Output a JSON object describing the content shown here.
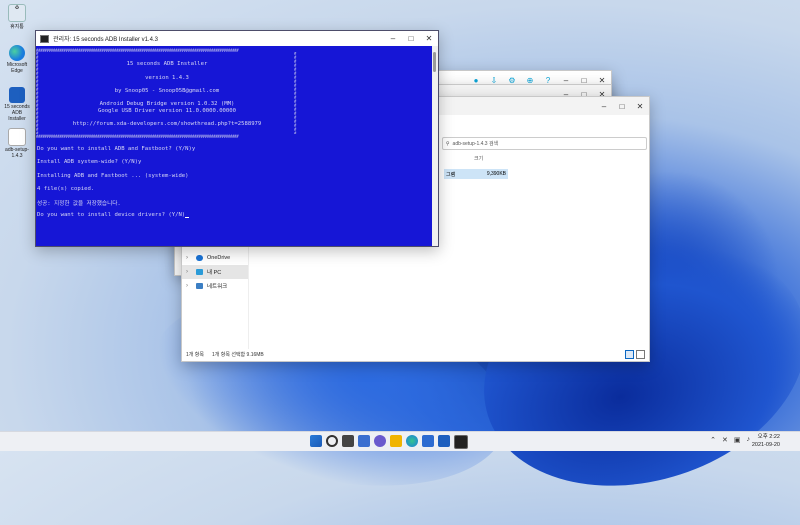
{
  "desktop": {
    "icons": [
      {
        "label": "휴지통",
        "icon": "recycle-bin-icon"
      },
      {
        "label": "Microsoft Edge",
        "icon": "edge-icon"
      },
      {
        "label": "15 seconds ADB Installer",
        "icon": "installer-icon"
      },
      {
        "label": "adb-setup-1.4.3",
        "icon": "file-icon"
      }
    ]
  },
  "console": {
    "title": "관리자: 15 seconds ADB Installer v1.4.3",
    "banner": [
      "15 seconds ADB Installer",
      "version 1.4.3",
      "by Snoop05 - Snoop05B@gmail.com",
      "Android Debug Bridge version 1.0.32 (MM)",
      "Google USB Driver version 11.0.0000.00000",
      "http://forum.xda-developers.com/showthread.php?t=2588979"
    ],
    "lines": [
      "Do you want to install ADB and Fastboot? (Y/N)y",
      "Install ADB system-wide? (Y/N)y",
      "Installing ADB and Fastboot ... (system-wide)",
      "4 file(s) copied.",
      "성공: 지정한 값을 저장했습니다.",
      "Do you want to install device drivers? (Y/N)"
    ]
  },
  "explorer": {
    "search_placeholder": "adb-setup-1.4.3 검색",
    "column_size": "크기",
    "file_type": "그램",
    "file_size": "9,390KB",
    "sidebar": [
      {
        "label": "",
        "icon": "star-icon"
      },
      {
        "label": "OneDrive",
        "icon": "cloud-icon"
      },
      {
        "label": "내 PC",
        "icon": "computer-icon",
        "selected": true
      },
      {
        "label": "네트워크",
        "icon": "network-icon"
      }
    ],
    "status_count": "1개 항목",
    "status_selected": "1개 항목 선택함 9.16MB"
  },
  "taskbar": {
    "time": "오후 2:22",
    "date": "2021-09-20"
  },
  "colors": {
    "console_bg": "#1616d6",
    "accent": "#0a67c2"
  }
}
